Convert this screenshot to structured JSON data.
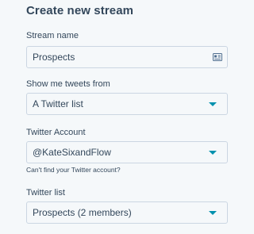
{
  "title": "Create new stream",
  "stream_name": {
    "label": "Stream name",
    "value": "Prospects",
    "icon": "contact-card-icon"
  },
  "show_tweets_from": {
    "label": "Show me tweets from",
    "selected": "A Twitter list"
  },
  "twitter_account": {
    "label": "Twitter Account",
    "selected": "@KateSixandFlow",
    "help_text": "Can't find your Twitter account?"
  },
  "twitter_list": {
    "label": "Twitter list",
    "selected": "Prospects (2 members)"
  },
  "colors": {
    "text": "#33475b",
    "border": "#cbd6e2",
    "background": "#f5f8fa",
    "accent_caret": "#0091ae"
  }
}
